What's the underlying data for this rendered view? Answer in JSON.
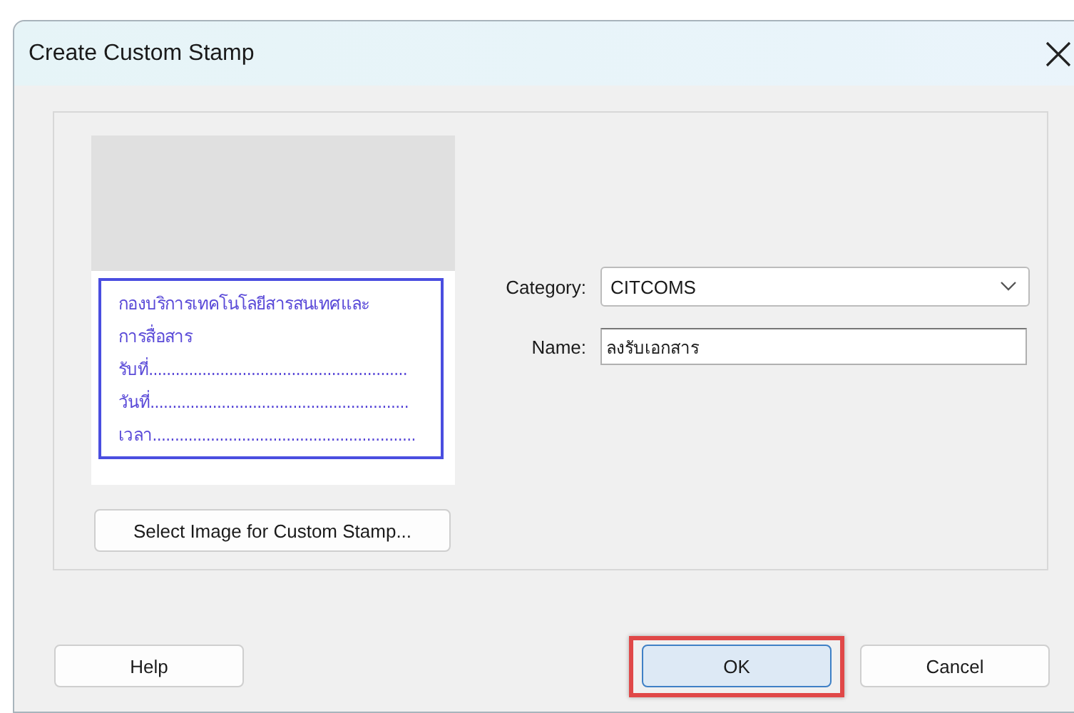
{
  "window": {
    "title": "Create Custom Stamp"
  },
  "stamp_preview": {
    "lines": [
      "กองบริการเทคโนโลยีสารสนเทศและ",
      "การสื่อสาร",
      "รับที่..........................................................",
      "วันที่..........................................................",
      "เวลา..........................................................."
    ]
  },
  "select_image_button": "Select Image for Custom Stamp...",
  "category": {
    "label": "Category:",
    "value": "CITCOMS"
  },
  "name": {
    "label": "Name:",
    "value": "ลงรับเอกสาร"
  },
  "buttons": [
    {
      "label": "Help",
      "default": false,
      "highlighted": false
    },
    {
      "label": "OK",
      "default": true,
      "highlighted": true
    },
    {
      "label": "Cancel",
      "default": false,
      "highlighted": false
    }
  ]
}
